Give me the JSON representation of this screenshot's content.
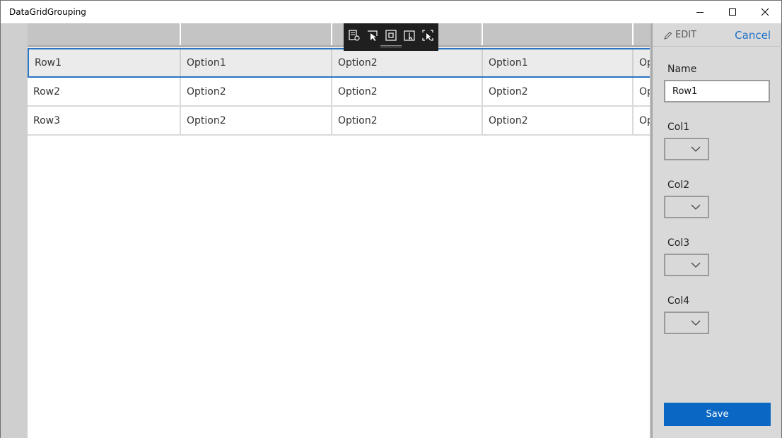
{
  "window": {
    "title": "DataGridGrouping",
    "minimize_icon": "minimize-icon",
    "maximize_icon": "maximize-icon",
    "close_icon": "close-icon"
  },
  "grid": {
    "columns": [
      "",
      "",
      "",
      "",
      ""
    ],
    "rows": [
      {
        "cells": [
          "Row1",
          "Option1",
          "Option2",
          "Option1",
          "Op"
        ],
        "selected": true
      },
      {
        "cells": [
          "Row2",
          "Option2",
          "Option2",
          "Option2",
          "Op"
        ],
        "selected": false
      },
      {
        "cells": [
          "Row3",
          "Option2",
          "Option2",
          "Option2",
          "Op"
        ],
        "selected": false
      }
    ],
    "selection_color": "#2a74c2"
  },
  "debug_toolbar": {
    "icons": [
      "live-visual-tree-icon",
      "select-element-icon",
      "display-layout-adorners-icon",
      "track-focus-icon",
      "preview-selection-icon"
    ]
  },
  "edit_panel": {
    "edit_label": "EDIT",
    "edit_icon": "pencil-icon",
    "cancel_label": "Cancel",
    "name_label": "Name",
    "name_value": "Row1",
    "col1_label": "Col1",
    "col2_label": "Col2",
    "col3_label": "Col3",
    "col4_label": "Col4",
    "save_label": "Save",
    "accent_color": "#0a67c4"
  }
}
